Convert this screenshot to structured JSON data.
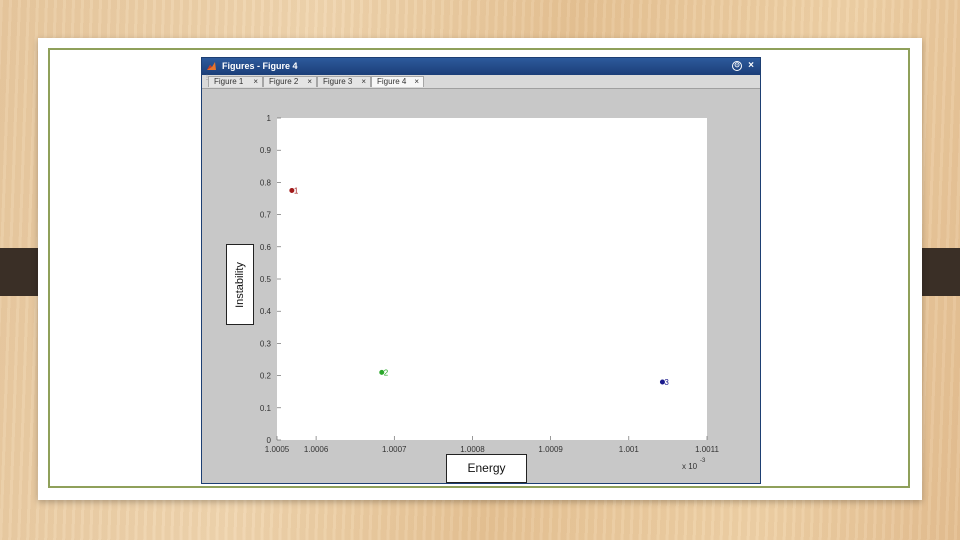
{
  "window": {
    "title": "Figures - Figure 4",
    "tabs": [
      {
        "label": "Figure 1",
        "active": false
      },
      {
        "label": "Figure 2",
        "active": false
      },
      {
        "label": "Figure 3",
        "active": false
      },
      {
        "label": "Figure 4",
        "active": true
      }
    ],
    "tab_close_glyph": "×",
    "menu_glyph": "⊙",
    "close_glyph": "×"
  },
  "colors": {
    "point1": "#a11a1a",
    "point2": "#2aa82a",
    "point3": "#1a1a8c"
  },
  "chart_data": {
    "type": "scatter",
    "xlabel": "Energy",
    "ylabel": "Instability",
    "x_multiplier_label": "x 10",
    "x_multiplier_exponent": "-3",
    "xlim": [
      1.00055,
      1.0011
    ],
    "ylim": [
      0,
      1
    ],
    "x_ticks": [
      "1.0005",
      "1.0006",
      "1.0007",
      "1.0008",
      "1.0009",
      "1.001",
      "1.0011"
    ],
    "y_ticks": [
      "0",
      "0.1",
      "0.2",
      "0.3",
      "0.4",
      "0.5",
      "0.6",
      "0.7",
      "0.8",
      "0.9",
      "1"
    ],
    "points": [
      {
        "label": "1",
        "x": 1.000569,
        "y": 0.775
      },
      {
        "label": "2",
        "x": 1.000684,
        "y": 0.21
      },
      {
        "label": "3",
        "x": 1.001043,
        "y": 0.18
      }
    ],
    "grid": false
  }
}
